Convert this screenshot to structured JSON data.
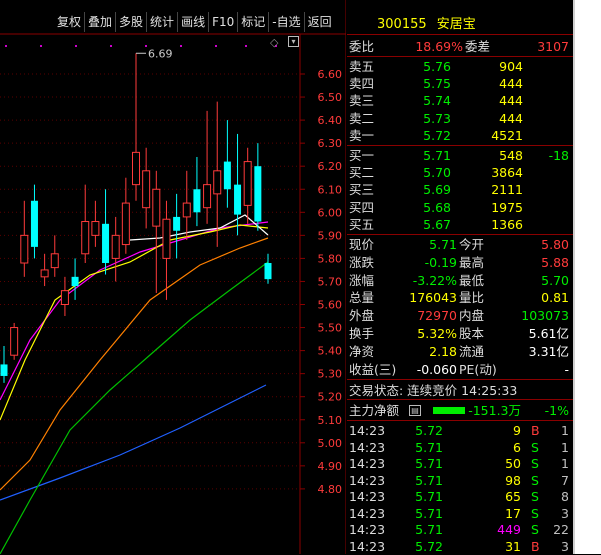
{
  "toolbar": {
    "buttons": [
      "复权",
      "叠加",
      "多股",
      "统计",
      "画线",
      "F10",
      "标记",
      "-自选",
      "返回"
    ]
  },
  "stock": {
    "code": "300155",
    "name": "安居宝"
  },
  "kline": {
    "high_label": "6.69",
    "price_axis": [
      "6.60",
      "6.50",
      "6.40",
      "6.30",
      "6.20",
      "6.10",
      "6.00",
      "5.90",
      "5.80",
      "5.70",
      "5.60",
      "5.50",
      "5.40",
      "5.30",
      "5.20",
      "5.10",
      "5.00",
      "4.90",
      "4.80"
    ],
    "candles": [
      {
        "o": 5.34,
        "c": 5.29,
        "h": 5.42,
        "l": 5.26
      },
      {
        "o": 5.38,
        "c": 5.5,
        "h": 5.52,
        "l": 5.36
      },
      {
        "o": 5.78,
        "c": 5.9,
        "h": 6.05,
        "l": 5.72
      },
      {
        "o": 6.05,
        "c": 5.85,
        "h": 6.12,
        "l": 5.8
      },
      {
        "o": 5.72,
        "c": 5.75,
        "h": 5.82,
        "l": 5.68
      },
      {
        "o": 5.76,
        "c": 5.82,
        "h": 5.9,
        "l": 5.72
      },
      {
        "o": 5.6,
        "c": 5.66,
        "h": 5.72,
        "l": 5.55
      },
      {
        "o": 5.72,
        "c": 5.68,
        "h": 5.8,
        "l": 5.62
      },
      {
        "o": 5.82,
        "c": 5.96,
        "h": 6.12,
        "l": 5.78
      },
      {
        "o": 5.9,
        "c": 5.96,
        "h": 6.05,
        "l": 5.85
      },
      {
        "o": 5.95,
        "c": 5.78,
        "h": 6.1,
        "l": 5.73
      },
      {
        "o": 5.8,
        "c": 5.9,
        "h": 5.98,
        "l": 5.7
      },
      {
        "o": 5.86,
        "c": 6.04,
        "h": 6.15,
        "l": 5.82
      },
      {
        "o": 6.12,
        "c": 6.26,
        "h": 6.69,
        "l": 6.05
      },
      {
        "o": 6.02,
        "c": 6.18,
        "h": 6.28,
        "l": 5.93
      },
      {
        "o": 5.94,
        "c": 6.1,
        "h": 6.18,
        "l": 5.65
      },
      {
        "o": 5.8,
        "c": 5.97,
        "h": 6.05,
        "l": 5.62
      },
      {
        "o": 5.98,
        "c": 5.92,
        "h": 6.08,
        "l": 5.8
      },
      {
        "o": 5.98,
        "c": 6.04,
        "h": 6.18,
        "l": 5.88
      },
      {
        "o": 6.1,
        "c": 6.0,
        "h": 6.24,
        "l": 5.94
      },
      {
        "o": 6.02,
        "c": 6.12,
        "h": 6.44,
        "l": 5.95
      },
      {
        "o": 6.08,
        "c": 6.18,
        "h": 6.48,
        "l": 5.85
      },
      {
        "o": 6.22,
        "c": 6.1,
        "h": 6.4,
        "l": 6.02
      },
      {
        "o": 6.12,
        "c": 5.99,
        "h": 6.34,
        "l": 5.9
      },
      {
        "o": 6.03,
        "c": 6.22,
        "h": 6.28,
        "l": 5.95
      },
      {
        "o": 6.2,
        "c": 5.96,
        "h": 6.3,
        "l": 5.92
      },
      {
        "o": 5.78,
        "c": 5.71,
        "h": 5.82,
        "l": 5.69
      }
    ]
  },
  "quote": {
    "weibi_label": "委比",
    "weibi": "18.69%",
    "weicha_label": "委差",
    "weicha": "3107",
    "asks": [
      {
        "label": "卖五",
        "price": "5.76",
        "vol": "904",
        "chg": ""
      },
      {
        "label": "卖四",
        "price": "5.75",
        "vol": "444",
        "chg": ""
      },
      {
        "label": "卖三",
        "price": "5.74",
        "vol": "444",
        "chg": ""
      },
      {
        "label": "卖二",
        "price": "5.73",
        "vol": "444",
        "chg": ""
      },
      {
        "label": "卖一",
        "price": "5.72",
        "vol": "4521",
        "chg": ""
      }
    ],
    "bids": [
      {
        "label": "买一",
        "price": "5.71",
        "vol": "548",
        "chg": "-18"
      },
      {
        "label": "买二",
        "price": "5.70",
        "vol": "3864",
        "chg": ""
      },
      {
        "label": "买三",
        "price": "5.69",
        "vol": "2111",
        "chg": ""
      },
      {
        "label": "买四",
        "price": "5.68",
        "vol": "1975",
        "chg": ""
      },
      {
        "label": "买五",
        "price": "5.67",
        "vol": "1366",
        "chg": ""
      }
    ],
    "stats": [
      {
        "l1": "现价",
        "v1": "5.71",
        "l2": "今开",
        "v2": "5.80"
      },
      {
        "l1": "涨跌",
        "v1": "-0.19",
        "l2": "最高",
        "v2": "5.88"
      },
      {
        "l1": "涨幅",
        "v1": "-3.22%",
        "l2": "最低",
        "v2": "5.70"
      },
      {
        "l1": "总量",
        "v1": "176043",
        "l2": "量比",
        "v2": "0.81"
      },
      {
        "l1": "外盘",
        "v1": "72970",
        "l2": "内盘",
        "v2": "103073"
      },
      {
        "l1": "换手",
        "v1": "5.32%",
        "l2": "股本",
        "v2": "5.61亿"
      },
      {
        "l1": "净资",
        "v1": "2.18",
        "l2": "流通",
        "v2": "3.31亿"
      },
      {
        "l1": "收益(三)",
        "v1": "-0.060",
        "l2": "PE(动)",
        "v2": "-"
      }
    ],
    "trade_status": "交易状态: 连续竞价 14:25:33",
    "main_net_label": "主力净额",
    "main_net_value": "-151.3万",
    "main_net_pct": "-1%"
  },
  "ticks": [
    {
      "time": "14:23",
      "price": "5.72",
      "vol": "9",
      "bs": "B",
      "cnt": "1"
    },
    {
      "time": "14:23",
      "price": "5.71",
      "vol": "6",
      "bs": "S",
      "cnt": "1"
    },
    {
      "time": "14:23",
      "price": "5.71",
      "vol": "50",
      "bs": "S",
      "cnt": "1"
    },
    {
      "time": "14:23",
      "price": "5.71",
      "vol": "98",
      "bs": "S",
      "cnt": "7"
    },
    {
      "time": "14:23",
      "price": "5.71",
      "vol": "65",
      "bs": "S",
      "cnt": "8"
    },
    {
      "time": "14:23",
      "price": "5.71",
      "vol": "17",
      "bs": "S",
      "cnt": "3"
    },
    {
      "time": "14:23",
      "price": "5.71",
      "vol": "449",
      "bs": "S",
      "cnt": "22"
    },
    {
      "time": "14:23",
      "price": "5.72",
      "vol": "31",
      "bs": "B",
      "cnt": "3"
    }
  ],
  "colors": {
    "up": "#ff3b3b",
    "down": "#00ffff",
    "ma5": "#ffffff",
    "ma10": "#ffff00",
    "ma20": "#ff00ff",
    "ma30": "#00c000",
    "ma60": "#ff8000",
    "ma120": "#2060ff"
  }
}
